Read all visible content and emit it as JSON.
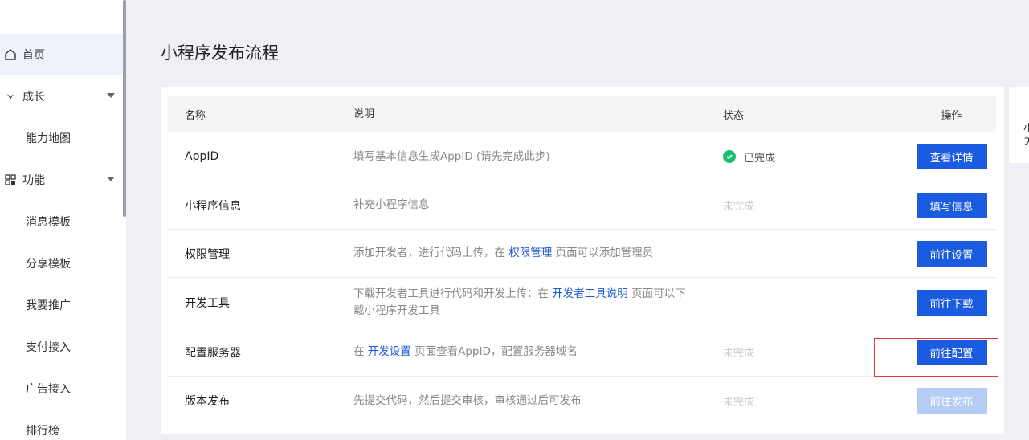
{
  "sidebar": {
    "items": [
      {
        "label": "首页",
        "icon": "home-icon",
        "active": true
      },
      {
        "label": "成长",
        "icon": "growth-icon",
        "expandable": true
      },
      {
        "label": "能力地图",
        "sub": true
      },
      {
        "label": "功能",
        "icon": "grid-icon",
        "expandable": true
      },
      {
        "label": "消息模板",
        "sub": true
      },
      {
        "label": "分享模板",
        "sub": true
      },
      {
        "label": "我要推广",
        "sub": true
      },
      {
        "label": "支付接入",
        "sub": true
      },
      {
        "label": "广告接入",
        "sub": true
      },
      {
        "label": "排行榜",
        "sub": true
      }
    ]
  },
  "main": {
    "title": "小程序发布流程",
    "table": {
      "headers": {
        "name": "名称",
        "desc": "说明",
        "status": "状态",
        "op": "操作"
      },
      "rows": [
        {
          "name": "AppID",
          "desc_pre": "填写基本信息生成AppID (请先完成此步)",
          "desc_link": "",
          "desc_post": "",
          "status": "已完成",
          "done": true,
          "button": "查看详情"
        },
        {
          "name": "小程序信息",
          "desc_pre": "补充小程序信息",
          "desc_link": "",
          "desc_post": "",
          "status": "未完成",
          "done": false,
          "button": "填写信息"
        },
        {
          "name": "权限管理",
          "desc_pre": "添加开发者，进行代码上传，在 ",
          "desc_link": "权限管理",
          "desc_post": " 页面可以添加管理员",
          "status": "",
          "done": false,
          "button": "前往设置"
        },
        {
          "name": "开发工具",
          "desc_pre": "下载开发者工具进行代码和开发上传：在 ",
          "desc_link": "开发者工具说明",
          "desc_post": " 页面可以下载小程序开发工具",
          "status": "",
          "done": false,
          "button": "前往下载"
        },
        {
          "name": "配置服务器",
          "desc_pre": "在 ",
          "desc_link": "开发设置",
          "desc_post": " 页面查看AppID，配置服务器域名",
          "status": "未完成",
          "done": false,
          "button": "前往配置"
        },
        {
          "name": "版本发布",
          "desc_pre": "先提交代码，然后提交审核，审核通过后可发布",
          "desc_link": "",
          "desc_post": "",
          "status": "未完成",
          "done": false,
          "button": "前往发布",
          "disabled": true
        }
      ]
    }
  },
  "right_panel": {
    "text": "小\n关"
  },
  "colors": {
    "accent": "#1a5be0",
    "success": "#1bbf73",
    "highlight": "#e0393e"
  }
}
